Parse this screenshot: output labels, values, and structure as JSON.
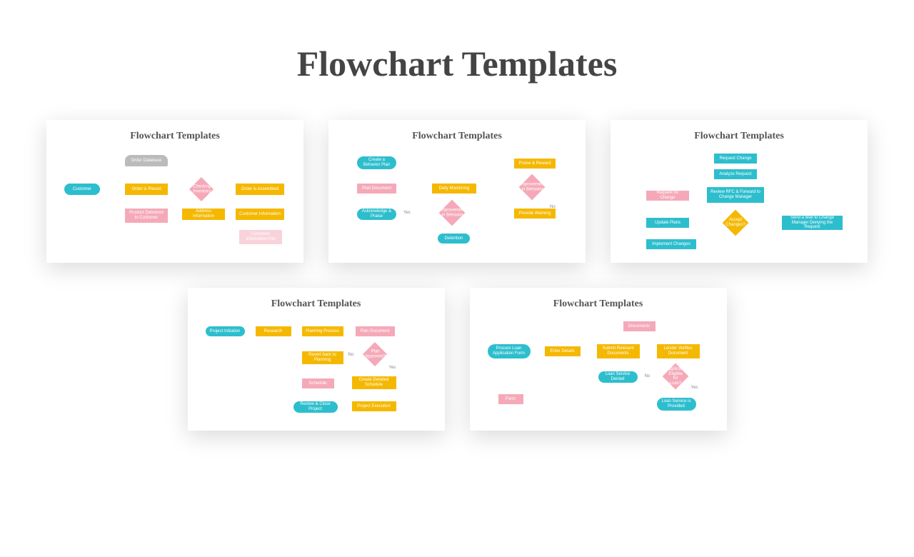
{
  "title": "Flowchart Templates",
  "card_title": "Flowchart Templates",
  "c1": {
    "customer": "Customer",
    "order_db": "Order Database",
    "order_placed": "Order is Placed",
    "check_inv": "Checking Inventory",
    "assembled": "Order is Assembled",
    "delivered": "Product Delivered to Customer",
    "addr_info": "Address Information",
    "cust_info": "Customer Information",
    "cust_file": "Customer Information File"
  },
  "c2": {
    "create_plan": "Create a Behavior Plan",
    "plan_doc": "Plan Document",
    "monitoring": "Daily Monitoring",
    "praise": "Praise & Reward",
    "improve": "Improvement in Behavior",
    "ack": "Acknowledge & Praise",
    "warn": "Provide Warning",
    "detention": "Detention",
    "yes": "Yes",
    "no": "No"
  },
  "c3": {
    "req_change": "Request Change",
    "analyze": "Analyze Request",
    "req_for": "Request for Change",
    "review": "Review RFC & Forward to Change Manager",
    "update": "Update Plans",
    "accept": "Accept Changes?",
    "send_mail": "Send a Mail to Change Manager Denying the Request",
    "implement": "Implement Changes"
  },
  "c4": {
    "init": "Project Initiation",
    "research": "Research",
    "planning": "Planning Process",
    "plan_doc": "Plan Document",
    "revert": "Revert back to Planning",
    "approved": "Plan Approved?",
    "schedule": "Schedule",
    "detailed": "Create Detailed Schedule",
    "review": "Review & Close Project",
    "execute": "Project Execution",
    "yes": "Yes",
    "no": "No"
  },
  "c5": {
    "procure": "Procure Loan Application Form",
    "enter": "Enter Details",
    "submit": "Submit Relevant Documents",
    "verify": "Lender Verifies Document",
    "docs": "Documents",
    "denied": "Loan Service Denied",
    "eligible": "Applicant Eligible for Loan?",
    "provided": "Loan Service is Provided",
    "form": "Form",
    "yes": "Yes",
    "no": "No"
  }
}
